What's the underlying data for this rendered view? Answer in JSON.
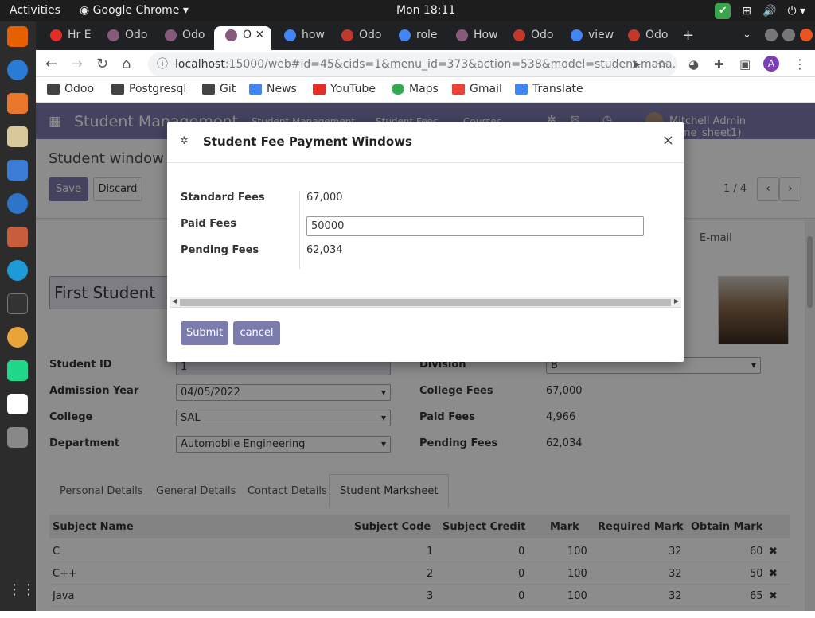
{
  "system": {
    "activities": "Activities",
    "app_name": "Google Chrome",
    "clock": "Mon 18:11"
  },
  "browser": {
    "tabs": [
      {
        "label": "Hr E",
        "color": "#e52d27"
      },
      {
        "label": "Odo",
        "color": "#875a7b"
      },
      {
        "label": "Odo",
        "color": "#875a7b"
      },
      {
        "label": "O",
        "color": "#875a7b"
      },
      {
        "label": "how",
        "color": "#4285f4"
      },
      {
        "label": "Odo",
        "color": "#c0392b"
      },
      {
        "label": "role",
        "color": "#4285f4"
      },
      {
        "label": "How",
        "color": "#875a7b"
      },
      {
        "label": "Odo",
        "color": "#c0392b"
      },
      {
        "label": "view",
        "color": "#4285f4"
      },
      {
        "label": "Odo",
        "color": "#c0392b"
      }
    ],
    "url_host": "localhost",
    "url_rest": ":15000/web#id=45&cids=1&menu_id=373&action=538&model=student.mana...",
    "profile_initial": "A",
    "bookmarks": [
      {
        "label": "Odoo",
        "color": "#444"
      },
      {
        "label": "Postgresql",
        "color": "#444"
      },
      {
        "label": "Git",
        "color": "#444"
      },
      {
        "label": "News",
        "color": "#4285f4"
      },
      {
        "label": "YouTube",
        "color": "#e52d27"
      },
      {
        "label": "Maps",
        "color": "#34a853"
      },
      {
        "label": "Gmail",
        "color": "#ea4335"
      },
      {
        "label": "Translate",
        "color": "#4285f4"
      }
    ]
  },
  "odoo": {
    "brand": "Student Management",
    "menu": [
      "Student Management",
      "Student Fees",
      "Courses"
    ],
    "user": "Mitchell Admin (time_sheet1)",
    "breadcrumb": "Student window / 1",
    "save_label": "Save",
    "discard_label": "Discard",
    "pager": "1 / 4",
    "email_label": "E-mail",
    "student_name": "First Student",
    "fields": {
      "student_id_label": "Student ID",
      "student_id_value": "1",
      "admission_label": "Admission Year",
      "admission_value": "04/05/2022",
      "college_label": "College",
      "college_value": "SAL",
      "department_label": "Department",
      "department_value": "Automobile Engineering",
      "division_label": "Division",
      "division_value": "B",
      "college_fees_label": "College Fees",
      "college_fees_value": "67,000",
      "paid_fees_label": "Paid Fees",
      "paid_fees_value": "4,966",
      "pending_fees_label": "Pending Fees",
      "pending_fees_value": "62,034"
    },
    "notebook_tabs": [
      "Personal Details",
      "General Details",
      "Contact Details",
      "Student Marksheet"
    ],
    "marksheet": {
      "headers": [
        "Subject Name",
        "Subject Code",
        "Subject Credit",
        "Mark",
        "Required Mark",
        "Obtain Mark"
      ],
      "rows": [
        [
          "C",
          "1",
          "0",
          "100",
          "32",
          "60"
        ],
        [
          "C++",
          "2",
          "0",
          "100",
          "32",
          "50"
        ],
        [
          "Java",
          "3",
          "0",
          "100",
          "32",
          "65"
        ]
      ]
    }
  },
  "dialog": {
    "title": "Student Fee Payment Windows",
    "standard_fees_label": "Standard Fees",
    "standard_fees_value": "67,000",
    "paid_fees_label": "Paid Fees",
    "paid_fees_value": "50000",
    "pending_fees_label": "Pending Fees",
    "pending_fees_value": "62,034",
    "submit_label": "Submit",
    "cancel_label": "cancel"
  },
  "colors": {
    "odoo_primary": "#7c7bad",
    "topbar": "#1d1d1d",
    "dock": "#2c2c2c"
  }
}
